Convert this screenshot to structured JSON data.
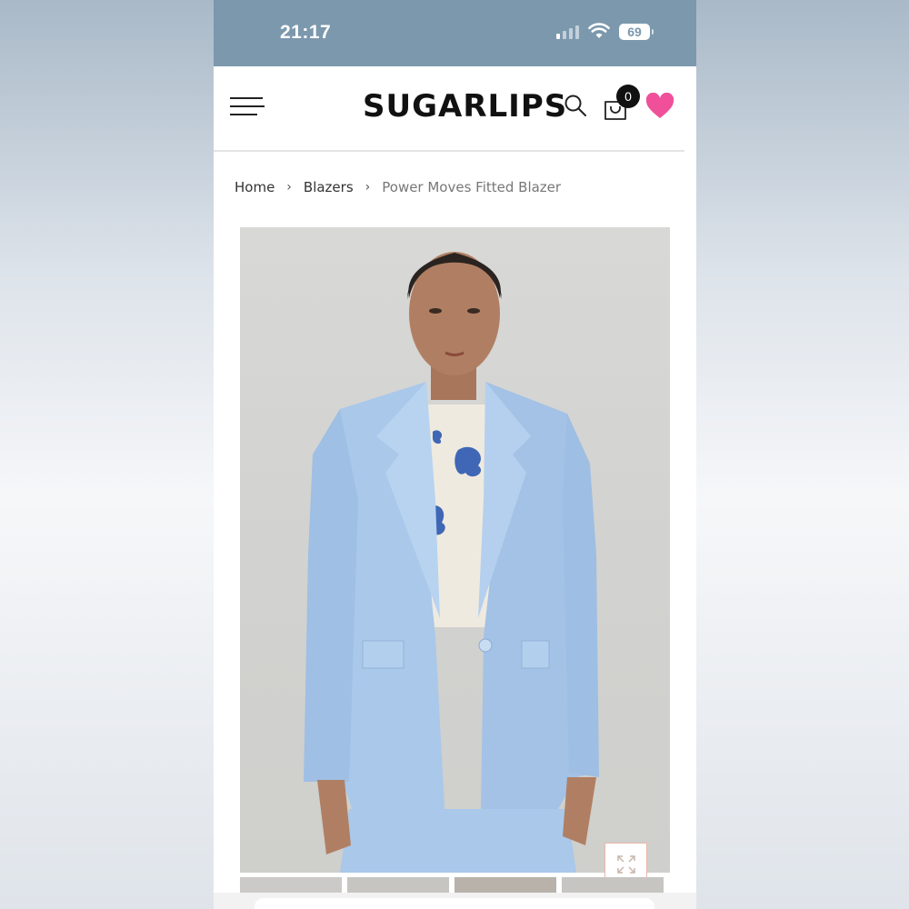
{
  "status_bar": {
    "time": "21:17",
    "battery": "69",
    "icons": [
      "signal-icon",
      "wifi-icon",
      "battery-icon"
    ]
  },
  "header": {
    "brand": "SUGARLIPS",
    "cart_count": "0",
    "icons": [
      "menu-icon",
      "search-icon",
      "cart-icon",
      "heart-icon"
    ],
    "heart_color": "#f0509a"
  },
  "breadcrumb": {
    "items": [
      "Home",
      "Blazers"
    ],
    "current": "Power Moves Fitted Blazer"
  },
  "product": {
    "image_icon": "product-photo",
    "expand_icon": "expand-icon",
    "thumbnail_count": 4
  },
  "colors": {
    "status_bar": "#7b98ad",
    "blazer": "#a9c8ea",
    "background": "#d5d5d3"
  }
}
